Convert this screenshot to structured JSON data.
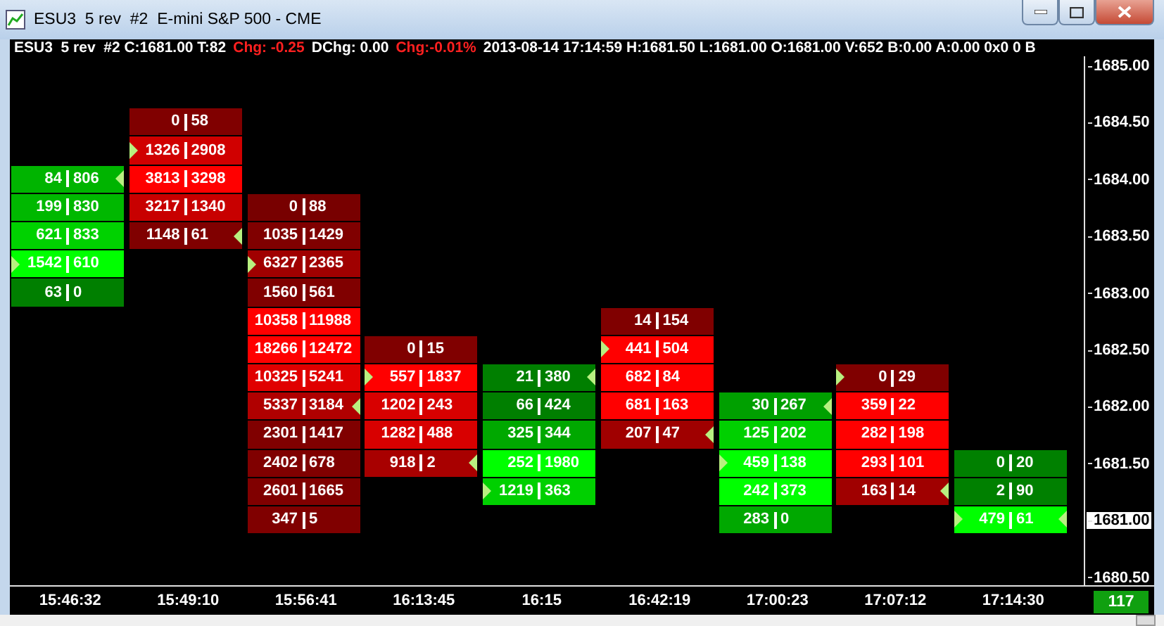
{
  "window": {
    "title": "ESU3  5 rev  #2  E-mini S&P 500 - CME"
  },
  "info_bar": [
    {
      "text": "ESU3  5 rev  #2 C:1681.00 T:82",
      "negative": false
    },
    {
      "text": "Chg: -0.25",
      "negative": true
    },
    {
      "text": "DChg: 0.00",
      "negative": false
    },
    {
      "text": "Chg:-0.01%",
      "negative": true
    },
    {
      "text": "2013-08-14 17:14:59 H:1681.50 L:1681.00 O:1681.00 V:652 B:0.00 A:0.00 0x0 0 B",
      "negative": false
    }
  ],
  "price_axis": [
    {
      "label": "1685.00",
      "current": false
    },
    {
      "label": "1684.50",
      "current": false
    },
    {
      "label": "1684.00",
      "current": false
    },
    {
      "label": "1683.50",
      "current": false
    },
    {
      "label": "1683.00",
      "current": false
    },
    {
      "label": "1682.50",
      "current": false
    },
    {
      "label": "1682.00",
      "current": false
    },
    {
      "label": "1681.50",
      "current": false
    },
    {
      "label": "1681.00",
      "current": true
    },
    {
      "label": "1680.50",
      "current": false
    }
  ],
  "columns": [
    {
      "time": "15:46:32",
      "cells": [
        {
          "kind": "empty"
        },
        {
          "kind": "empty"
        },
        {
          "kind": "empty"
        },
        {
          "kind": "empty"
        },
        {
          "bid": "84",
          "ask": "806",
          "color": "#00b400",
          "open": false,
          "close": true
        },
        {
          "bid": "199",
          "ask": "830",
          "color": "#00b800",
          "open": false,
          "close": false
        },
        {
          "bid": "621",
          "ask": "833",
          "color": "#00d200",
          "open": false,
          "close": false
        },
        {
          "bid": "1542",
          "ask": "610",
          "color": "#00ff00",
          "open": true,
          "close": false
        },
        {
          "bid": "63",
          "ask": "0",
          "color": "#007f00",
          "open": false,
          "close": false
        }
      ]
    },
    {
      "time": "15:49:10",
      "cells": [
        {
          "kind": "empty"
        },
        {
          "kind": "empty"
        },
        {
          "bid": "0",
          "ask": "58",
          "color": "#800000",
          "open": false,
          "close": false
        },
        {
          "bid": "1326",
          "ask": "2908",
          "color": "#d00000",
          "open": true,
          "close": false
        },
        {
          "bid": "3813",
          "ask": "3298",
          "color": "#ff0000",
          "open": false,
          "close": false
        },
        {
          "bid": "3217",
          "ask": "1340",
          "color": "#c80000",
          "open": false,
          "close": false
        },
        {
          "bid": "1148",
          "ask": "61",
          "color": "#800000",
          "open": false,
          "close": true
        }
      ]
    },
    {
      "time": "15:56:41",
      "cells": [
        {
          "kind": "empty"
        },
        {
          "kind": "empty"
        },
        {
          "kind": "empty"
        },
        {
          "kind": "empty"
        },
        {
          "kind": "empty"
        },
        {
          "bid": "0",
          "ask": "88",
          "color": "#780000",
          "open": false,
          "close": false
        },
        {
          "bid": "1035",
          "ask": "1429",
          "color": "#800000",
          "open": false,
          "close": false
        },
        {
          "bid": "6327",
          "ask": "2365",
          "color": "#a00000",
          "open": true,
          "close": false
        },
        {
          "bid": "1560",
          "ask": "561",
          "color": "#800000",
          "open": false,
          "close": false
        },
        {
          "bid": "10358",
          "ask": "11988",
          "color": "#ff0000",
          "open": false,
          "close": false
        },
        {
          "bid": "18266",
          "ask": "12472",
          "color": "#ff0000",
          "open": false,
          "close": false
        },
        {
          "bid": "10325",
          "ask": "5241",
          "color": "#e00000",
          "open": false,
          "close": false
        },
        {
          "bid": "5337",
          "ask": "3184",
          "color": "#b00000",
          "open": false,
          "close": true
        },
        {
          "bid": "2301",
          "ask": "1417",
          "color": "#800000",
          "open": false,
          "close": false
        },
        {
          "bid": "2402",
          "ask": "678",
          "color": "#800000",
          "open": false,
          "close": false
        },
        {
          "bid": "2601",
          "ask": "1665",
          "color": "#800000",
          "open": false,
          "close": false
        },
        {
          "bid": "347",
          "ask": "5",
          "color": "#800000",
          "open": false,
          "close": false
        }
      ]
    },
    {
      "time": "16:13:45",
      "cells": [
        {
          "kind": "empty"
        },
        {
          "kind": "empty"
        },
        {
          "kind": "empty"
        },
        {
          "kind": "empty"
        },
        {
          "kind": "empty"
        },
        {
          "kind": "empty"
        },
        {
          "kind": "empty"
        },
        {
          "kind": "empty"
        },
        {
          "kind": "empty"
        },
        {
          "kind": "empty"
        },
        {
          "bid": "0",
          "ask": "15",
          "color": "#800000",
          "open": false,
          "close": false
        },
        {
          "bid": "557",
          "ask": "1837",
          "color": "#ff0000",
          "open": true,
          "close": false
        },
        {
          "bid": "1202",
          "ask": "243",
          "color": "#d80000",
          "open": false,
          "close": false
        },
        {
          "bid": "1282",
          "ask": "488",
          "color": "#d80000",
          "open": false,
          "close": false
        },
        {
          "bid": "918",
          "ask": "2",
          "color": "#a80000",
          "open": false,
          "close": true
        }
      ]
    },
    {
      "time": "16:15",
      "cells": [
        {
          "kind": "empty"
        },
        {
          "kind": "empty"
        },
        {
          "kind": "empty"
        },
        {
          "kind": "empty"
        },
        {
          "kind": "empty"
        },
        {
          "kind": "empty"
        },
        {
          "kind": "empty"
        },
        {
          "kind": "empty"
        },
        {
          "kind": "empty"
        },
        {
          "kind": "empty"
        },
        {
          "kind": "empty"
        },
        {
          "bid": "21",
          "ask": "380",
          "color": "#007f00",
          "open": false,
          "close": true
        },
        {
          "bid": "66",
          "ask": "424",
          "color": "#007f00",
          "open": false,
          "close": false
        },
        {
          "bid": "325",
          "ask": "344",
          "color": "#00a800",
          "open": false,
          "close": false
        },
        {
          "bid": "252",
          "ask": "1980",
          "color": "#00ff00",
          "open": false,
          "close": false
        },
        {
          "bid": "1219",
          "ask": "363",
          "color": "#00d000",
          "open": true,
          "close": false
        }
      ]
    },
    {
      "time": "16:42:19",
      "cells": [
        {
          "kind": "empty"
        },
        {
          "kind": "empty"
        },
        {
          "kind": "empty"
        },
        {
          "kind": "empty"
        },
        {
          "kind": "empty"
        },
        {
          "kind": "empty"
        },
        {
          "kind": "empty"
        },
        {
          "kind": "empty"
        },
        {
          "kind": "empty"
        },
        {
          "bid": "14",
          "ask": "154",
          "color": "#800000",
          "open": false,
          "close": false
        },
        {
          "bid": "441",
          "ask": "504",
          "color": "#ff0000",
          "open": true,
          "close": false
        },
        {
          "bid": "682",
          "ask": "84",
          "color": "#ff0000",
          "open": false,
          "close": false
        },
        {
          "bid": "681",
          "ask": "163",
          "color": "#ff0000",
          "open": false,
          "close": false
        },
        {
          "bid": "207",
          "ask": "47",
          "color": "#a00000",
          "open": false,
          "close": true
        }
      ]
    },
    {
      "time": "17:00:23",
      "cells": [
        {
          "kind": "empty"
        },
        {
          "kind": "empty"
        },
        {
          "kind": "empty"
        },
        {
          "kind": "empty"
        },
        {
          "kind": "empty"
        },
        {
          "kind": "empty"
        },
        {
          "kind": "empty"
        },
        {
          "kind": "empty"
        },
        {
          "kind": "empty"
        },
        {
          "kind": "empty"
        },
        {
          "kind": "empty"
        },
        {
          "kind": "empty"
        },
        {
          "bid": "30",
          "ask": "267",
          "color": "#00a000",
          "open": false,
          "close": true
        },
        {
          "bid": "125",
          "ask": "202",
          "color": "#00d000",
          "open": false,
          "close": false
        },
        {
          "bid": "459",
          "ask": "138",
          "color": "#00ff00",
          "open": true,
          "close": false
        },
        {
          "bid": "242",
          "ask": "373",
          "color": "#00ff00",
          "open": false,
          "close": false
        },
        {
          "bid": "283",
          "ask": "0",
          "color": "#00a800",
          "open": false,
          "close": false
        }
      ]
    },
    {
      "time": "17:07:12",
      "cells": [
        {
          "kind": "empty"
        },
        {
          "kind": "empty"
        },
        {
          "kind": "empty"
        },
        {
          "kind": "empty"
        },
        {
          "kind": "empty"
        },
        {
          "kind": "empty"
        },
        {
          "kind": "empty"
        },
        {
          "kind": "empty"
        },
        {
          "kind": "empty"
        },
        {
          "kind": "empty"
        },
        {
          "kind": "empty"
        },
        {
          "bid": "0",
          "ask": "29",
          "color": "#800000",
          "open": true,
          "close": false
        },
        {
          "bid": "359",
          "ask": "22",
          "color": "#ff0000",
          "open": false,
          "close": false
        },
        {
          "bid": "282",
          "ask": "198",
          "color": "#ff0000",
          "open": false,
          "close": false
        },
        {
          "bid": "293",
          "ask": "101",
          "color": "#ff0000",
          "open": false,
          "close": false
        },
        {
          "bid": "163",
          "ask": "14",
          "color": "#a00000",
          "open": false,
          "close": true
        }
      ]
    },
    {
      "time": "17:14:30",
      "cells": [
        {
          "kind": "empty"
        },
        {
          "kind": "empty"
        },
        {
          "kind": "empty"
        },
        {
          "kind": "empty"
        },
        {
          "kind": "empty"
        },
        {
          "kind": "empty"
        },
        {
          "kind": "empty"
        },
        {
          "kind": "empty"
        },
        {
          "kind": "empty"
        },
        {
          "kind": "empty"
        },
        {
          "kind": "empty"
        },
        {
          "kind": "empty"
        },
        {
          "kind": "empty"
        },
        {
          "kind": "empty"
        },
        {
          "bid": "0",
          "ask": "20",
          "color": "#008000",
          "open": false,
          "close": false
        },
        {
          "bid": "2",
          "ask": "90",
          "color": "#008000",
          "open": false,
          "close": false
        },
        {
          "bid": "479",
          "ask": "61",
          "color": "#00ff00",
          "open": true,
          "close": true
        }
      ]
    }
  ],
  "bar_counter": "117"
}
